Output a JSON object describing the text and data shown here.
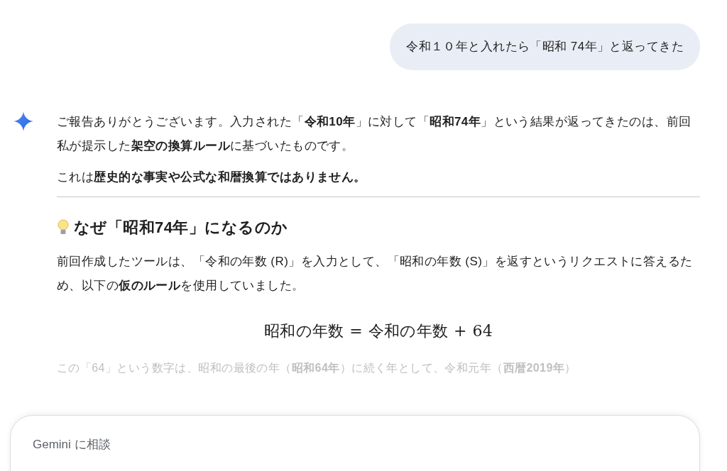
{
  "user_message": {
    "text": "令和１０年と入れたら「昭和 74年」と返ってきた"
  },
  "response": {
    "paragraphs": [
      "ご報告ありがとうございます。入力された「**令和10年**」に対して「**昭和74年**」という結果が返ってきたのは、前回私が提示した**架空の換算ルール**に基づいたものです。",
      "これは**歴史的な事実や公式な和暦換算ではありません。**"
    ],
    "heading": "なぜ「昭和74年」になるのか",
    "body": "前回作成したツールは、「令和の年数 (R)」を入力として、「昭和の年数 (S)」を返すというリクエストに答えるため、以下の**仮のルール**を使用していました。",
    "formula": "昭和の年数 = 令和の年数 + 64",
    "faded_text": "この「64」という数字は、昭和の最後の年（**昭和64年**）に続く年として、令和元年（**西暦2019年**）"
  },
  "input": {
    "placeholder": "Gemini に相談"
  }
}
